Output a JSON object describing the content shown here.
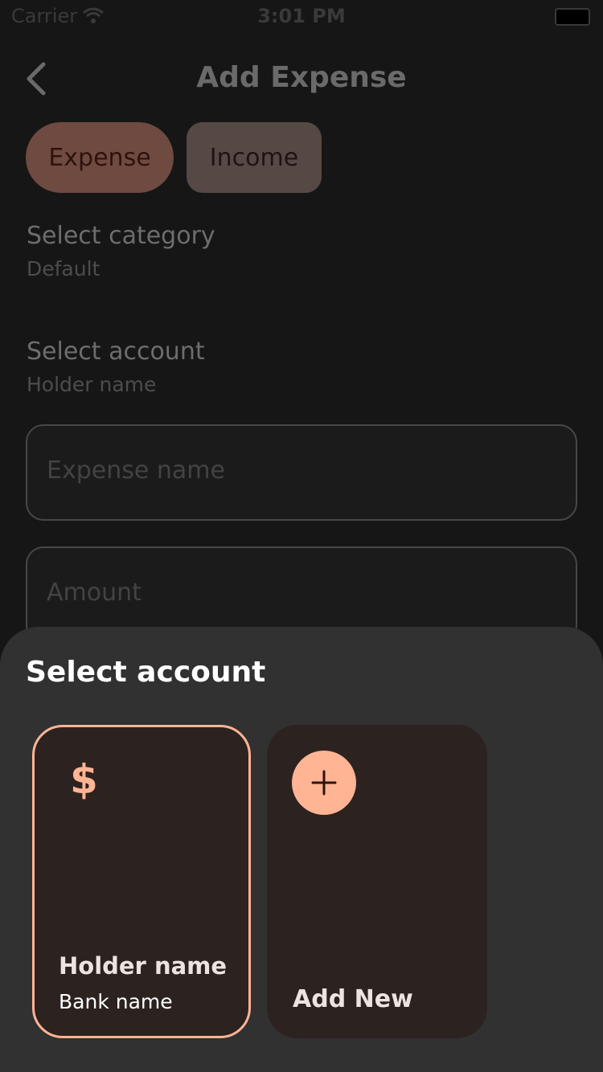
{
  "status_bar": {
    "carrier": "Carrier",
    "time": "3:01 PM"
  },
  "header": {
    "title": "Add Expense"
  },
  "type_toggle": {
    "expense_label": "Expense",
    "income_label": "Income"
  },
  "category": {
    "title": "Select category",
    "value": "Default"
  },
  "account": {
    "title": "Select account",
    "value": "Holder name"
  },
  "fields": {
    "expense_name_placeholder": "Expense name",
    "amount_placeholder": "Amount"
  },
  "sheet": {
    "title": "Select account",
    "accounts": [
      {
        "holder": "Holder name",
        "bank": "Bank name",
        "icon": "$"
      }
    ],
    "add_new_label": "Add New"
  },
  "colors": {
    "accent": "#ffb494",
    "card_bg": "#2c2220",
    "sheet_bg": "#313131",
    "page_bg": "#161616"
  }
}
